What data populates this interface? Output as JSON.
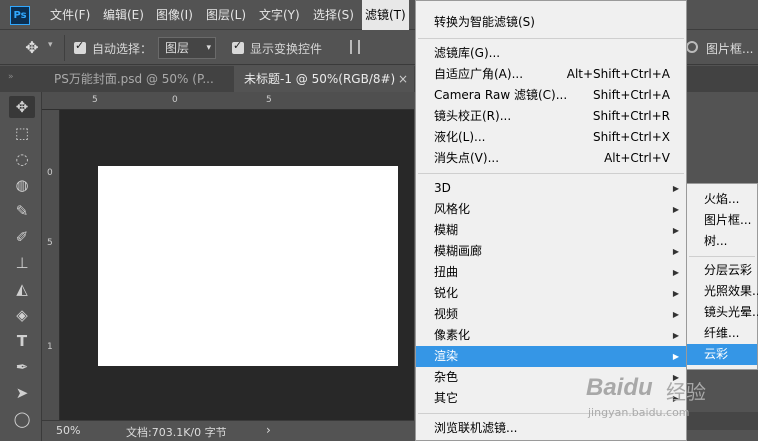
{
  "app": {
    "logo_text": "Ps"
  },
  "menubar": {
    "items": [
      "文件(F)",
      "编辑(E)",
      "图像(I)",
      "图层(L)",
      "文字(Y)",
      "选择(S)",
      "滤镜(T)"
    ]
  },
  "options": {
    "auto_select_label": "自动选择：",
    "auto_select_value": "图层",
    "show_transform_label": "显示变换控件"
  },
  "tabs": [
    {
      "label": "PS万能封面.psd @ 50% (P...",
      "close": "×"
    },
    {
      "label": "未标题-1 @ 50%(RGB/8#)",
      "close": "×"
    }
  ],
  "rulers": {
    "h_ticks": [
      "5",
      "0",
      "5"
    ],
    "v_ticks": [
      "0",
      "5",
      "1"
    ]
  },
  "status": {
    "zoom": "50%",
    "doc_info": "文档:703.1K/0 字节",
    "arrow": "›"
  },
  "filter_menu": {
    "items": [
      {
        "label": "转换为智能滤镜(S)",
        "shortcut": ""
      },
      {
        "label": "滤镜库(G)...",
        "shortcut": ""
      },
      {
        "label": "自适应广角(A)...",
        "shortcut": "Alt+Shift+Ctrl+A"
      },
      {
        "label": "Camera Raw 滤镜(C)...",
        "shortcut": "Shift+Ctrl+A"
      },
      {
        "label": "镜头校正(R)...",
        "shortcut": "Shift+Ctrl+R"
      },
      {
        "label": "液化(L)...",
        "shortcut": "Shift+Ctrl+X"
      },
      {
        "label": "消失点(V)...",
        "shortcut": "Alt+Ctrl+V"
      },
      {
        "label": "3D",
        "sub": true
      },
      {
        "label": "风格化",
        "sub": true
      },
      {
        "label": "模糊",
        "sub": true
      },
      {
        "label": "模糊画廊",
        "sub": true
      },
      {
        "label": "扭曲",
        "sub": true
      },
      {
        "label": "锐化",
        "sub": true
      },
      {
        "label": "视频",
        "sub": true
      },
      {
        "label": "像素化",
        "sub": true
      },
      {
        "label": "渲染",
        "sub": true,
        "highlighted": true
      },
      {
        "label": "杂色",
        "sub": true
      },
      {
        "label": "其它",
        "sub": true
      },
      {
        "label": "浏览联机滤镜...",
        "shortcut": ""
      }
    ]
  },
  "render_submenu": {
    "items": [
      {
        "label": "火焰..."
      },
      {
        "label": "图片框..."
      },
      {
        "label": "树..."
      },
      {
        "label": "分层云彩"
      },
      {
        "label": "光照效果..."
      },
      {
        "label": "镜头光晕..."
      },
      {
        "label": "纤维..."
      },
      {
        "label": "云彩",
        "highlighted": true
      }
    ]
  },
  "watermark": {
    "brand": "Baidu",
    "text": "经验",
    "url": "jingyan.baidu.com"
  },
  "colors": {
    "highlight": "#3596e6",
    "ui_bg": "#535353",
    "canvas_bg": "#282828",
    "menu_bg": "#f0f0f0"
  }
}
